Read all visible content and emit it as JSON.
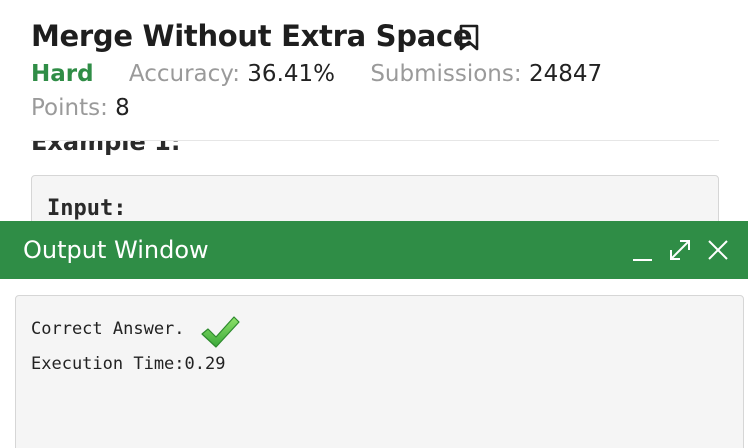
{
  "problem": {
    "title": "Merge Without Extra Space",
    "difficulty": "Hard",
    "accuracy_label": "Accuracy:",
    "accuracy_value": "36.41%",
    "submissions_label": "Submissions:",
    "submissions_value": "24847",
    "points_label": "Points:",
    "points_value": "8",
    "bookmark_icon": "bookmark-icon"
  },
  "example": {
    "heading": "Example 1:",
    "input_label": "Input:"
  },
  "output_window": {
    "title": "Output Window",
    "controls": [
      "minimize-icon",
      "expand-icon",
      "close-icon"
    ],
    "result_text": "Correct Answer.",
    "result_icon": "checkmark-icon",
    "execution_time": "Execution Time:0.29"
  },
  "colors": {
    "brand_green": "#2f8d46",
    "muted_gray": "#9a9a9a",
    "panel_bg": "#f5f5f5"
  }
}
